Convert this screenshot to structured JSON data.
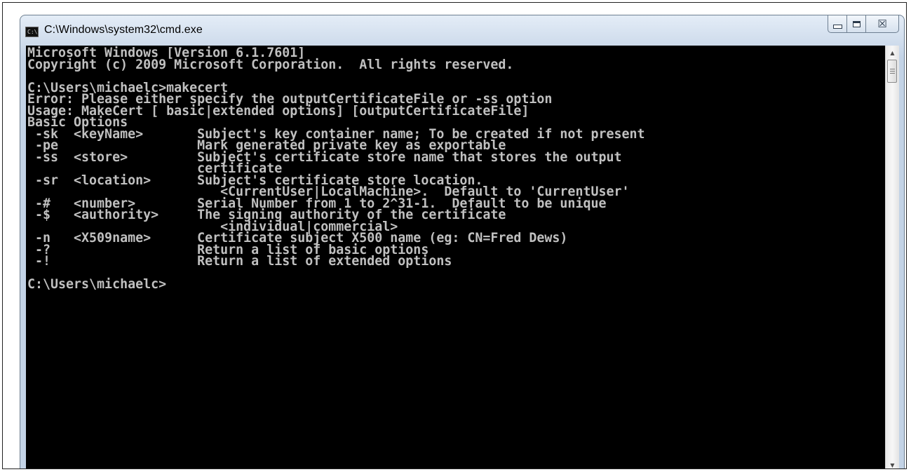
{
  "window": {
    "title": "C:\\Windows\\system32\\cmd.exe",
    "icon_name": "console-app-icon",
    "icon_text": "C:\\"
  },
  "caption_buttons": {
    "minimize_icon": "minimize-icon",
    "maximize_icon": "maximize-icon",
    "close_icon": "close-icon",
    "close_glyph": "☒"
  },
  "scrollbar": {
    "up_icon": "scroll-up-arrow-icon",
    "down_icon": "scroll-down-arrow-icon",
    "up_glyph": "▲",
    "down_glyph": "▼"
  },
  "colors": {
    "console_background": "#000000",
    "console_text": "#c0c0c0",
    "titlebar_gradient_top": "#e4edf7",
    "titlebar_gradient_bottom": "#c3d3e6"
  },
  "console": {
    "lines": [
      "Microsoft Windows [Version 6.1.7601]",
      "Copyright (c) 2009 Microsoft Corporation.  All rights reserved.",
      "",
      "C:\\Users\\michaelc>makecert",
      "Error: Please either specify the outputCertificateFile or -ss option",
      "Usage: MakeCert [ basic|extended options] [outputCertificateFile]",
      "Basic Options",
      " -sk  <keyName>       Subject's key container name; To be created if not present",
      " -pe                  Mark generated private key as exportable",
      " -ss  <store>         Subject's certificate store name that stores the output",
      "                      certificate",
      " -sr  <location>      Subject's certificate store location.",
      "                         <CurrentUser|LocalMachine>.  Default to 'CurrentUser'",
      " -#   <number>        Serial Number from 1 to 2^31-1.  Default to be unique",
      " -$   <authority>     The signing authority of the certificate",
      "                         <individual|commercial>",
      " -n   <X509name>      Certificate subject X500 name (eg: CN=Fred Dews)",
      " -?                   Return a list of basic options",
      " -!                   Return a list of extended options",
      "",
      "C:\\Users\\michaelc>"
    ]
  }
}
